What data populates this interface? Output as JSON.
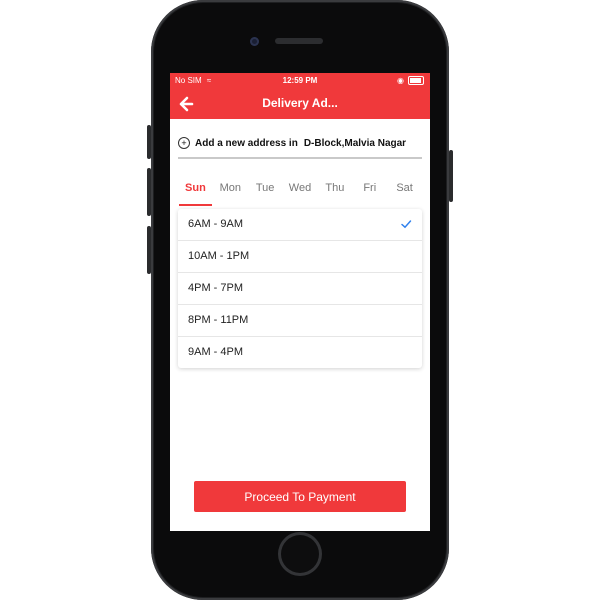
{
  "status": {
    "carrier": "No SIM",
    "time": "12:59 PM"
  },
  "nav": {
    "title": "Delivery Ad...",
    "back_icon": "back-arrow-icon"
  },
  "address": {
    "label": "Add a new address in",
    "location": "D-Block,Malvia Nagar",
    "icon": "add-circle-icon"
  },
  "days": [
    "Sun",
    "Mon",
    "Tue",
    "Wed",
    "Thu",
    "Fri",
    "Sat"
  ],
  "selected_day": "Sun",
  "slots": [
    "6AM - 9AM",
    "10AM - 1PM",
    "4PM - 7PM",
    "8PM - 11PM",
    "9AM - 4PM"
  ],
  "selected_slot": "6AM - 9AM",
  "proceed_label": "Proceed To Payment",
  "colors": {
    "accent": "#f0393b",
    "check": "#2f80ed"
  }
}
